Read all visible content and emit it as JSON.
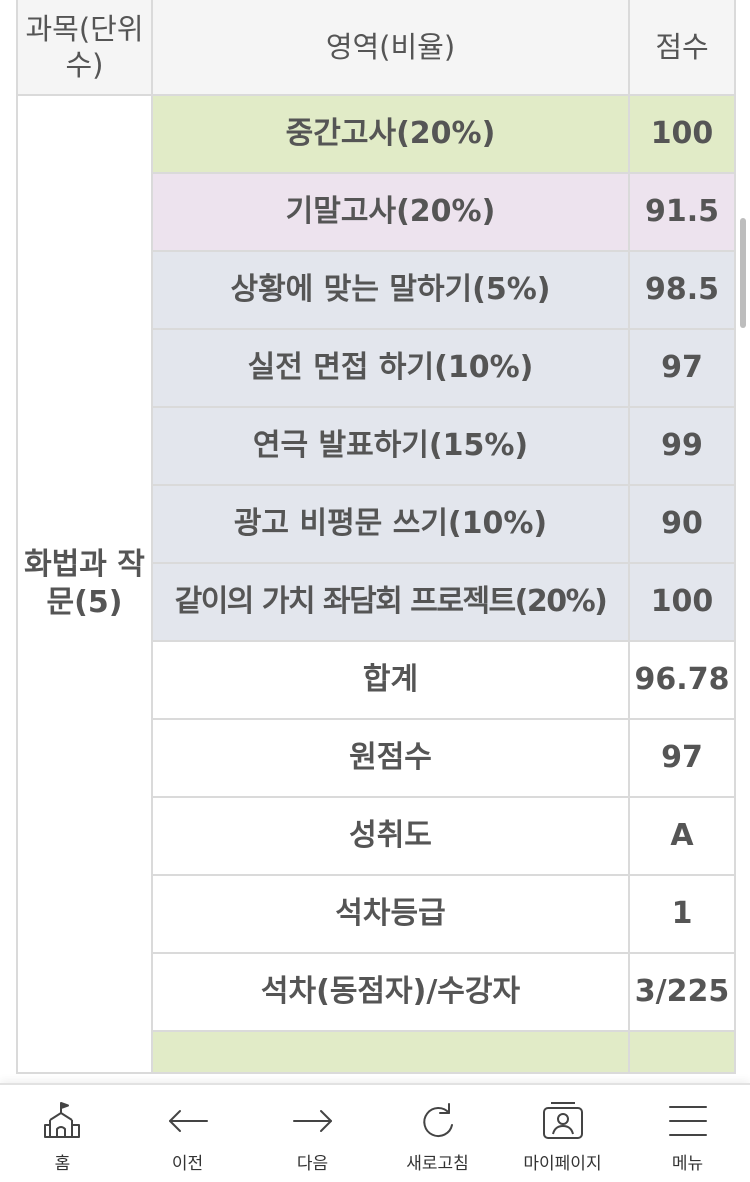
{
  "table": {
    "header": {
      "subject": "과목(단위수)",
      "area": "영역(비율)",
      "score": "점수"
    },
    "subject": "화법과 작문(5)",
    "rows": [
      {
        "area": "중간고사(20%)",
        "score": "100"
      },
      {
        "area": "기말고사(20%)",
        "score": "91.5"
      },
      {
        "area": "상황에 맞는 말하기(5%)",
        "score": "98.5"
      },
      {
        "area": "실전 면접 하기(10%)",
        "score": "97"
      },
      {
        "area": "연극 발표하기(15%)",
        "score": "99"
      },
      {
        "area": "광고 비평문 쓰기(10%)",
        "score": "90"
      },
      {
        "area": "같이의 가치 좌담회 프로젝트(20%)",
        "score": "100"
      },
      {
        "area": "합계",
        "score": "96.78"
      },
      {
        "area": "원점수",
        "score": "97"
      },
      {
        "area": "성취도",
        "score": "A"
      },
      {
        "area": "석차등급",
        "score": "1"
      },
      {
        "area": "석차(동점자)/수강자",
        "score": "3/225"
      }
    ]
  },
  "colors": {
    "midterm": "#e1ebc7",
    "final": "#ede3ee",
    "performance": "#e3e6ed",
    "header": "#f5f5f5",
    "border": "#dadada"
  },
  "bottom_nav": {
    "items": [
      {
        "label": "홈",
        "icon": "home-icon"
      },
      {
        "label": "이전",
        "icon": "arrow-left-icon"
      },
      {
        "label": "다음",
        "icon": "arrow-right-icon"
      },
      {
        "label": "새로고침",
        "icon": "refresh-icon"
      },
      {
        "label": "마이페이지",
        "icon": "user-card-icon"
      },
      {
        "label": "메뉴",
        "icon": "menu-icon"
      }
    ]
  }
}
